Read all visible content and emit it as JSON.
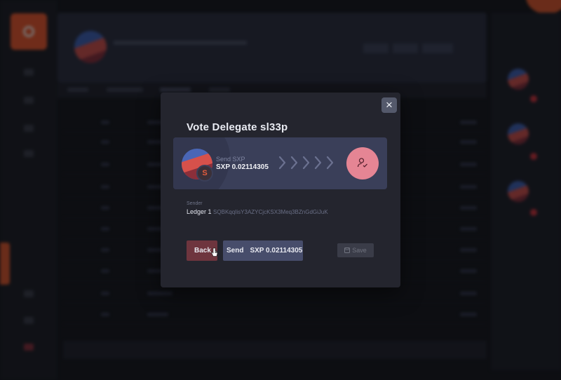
{
  "modal": {
    "title": "Vote Delegate sl33p",
    "close_icon": "close-icon",
    "transfer": {
      "send_label": "Send SXP",
      "amount": "SXP 0.02114305",
      "coin_badge": "S",
      "arrows": "›››››",
      "delegate_icon": "user-check-icon"
    },
    "sender": {
      "caption": "Sender",
      "name": "Ledger 1",
      "address": "SQBKqqIisY3AZYCjcKSX3Meq3BZnGdGiJuK"
    },
    "buttons": {
      "back": "Back",
      "send_prefix": "Send",
      "send_amount": "SXP 0.02114305",
      "save": "Save",
      "save_icon": "save-icon"
    }
  },
  "colors": {
    "accent_orange": "#f0582a",
    "delegate_pink": "#e58594",
    "back_button": "#6e353e",
    "send_button": "#474d6b"
  }
}
